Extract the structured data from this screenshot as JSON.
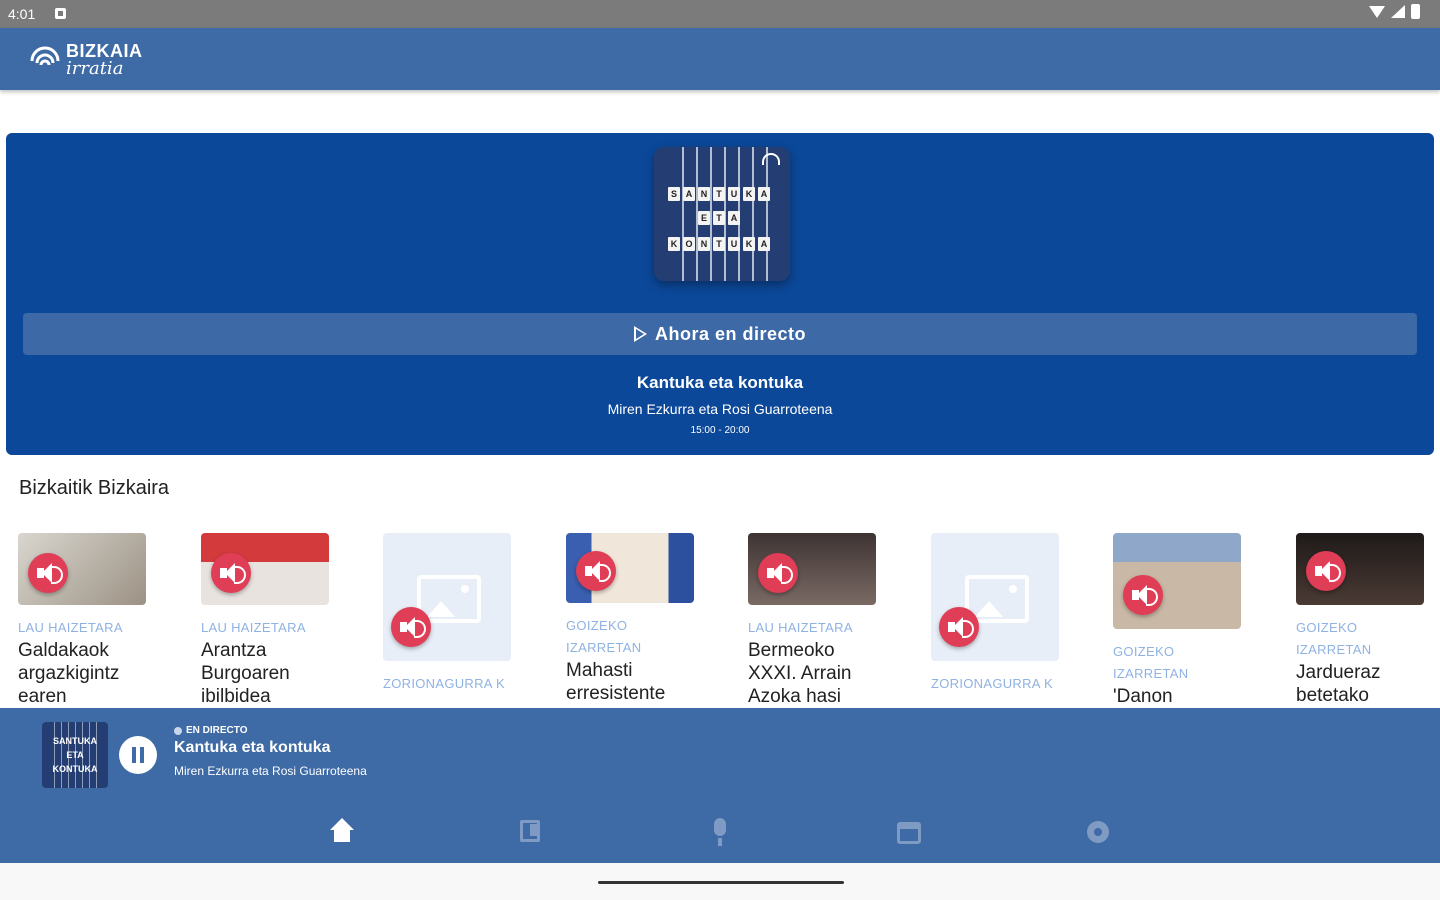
{
  "status_bar": {
    "time": "4:01"
  },
  "app": {
    "logo_line1": "BIZKAIA",
    "logo_line2": "irratia"
  },
  "hero": {
    "cover_rows": [
      [
        "S",
        "A",
        "N",
        "T",
        "U",
        "K",
        "A"
      ],
      [
        "E",
        "T",
        "A"
      ],
      [
        "K",
        "O",
        "N",
        "T",
        "U",
        "K",
        "A"
      ]
    ],
    "live_button_label": "Ahora en directo",
    "program_title": "Kantuka eta kontuka",
    "hosts": "Miren Ezkurra eta Rosi Guarroteena",
    "hours": "15:00 - 20:00"
  },
  "section": {
    "title": "Bizkaitik Bizkaira"
  },
  "cards": [
    {
      "category": "LAU HAIZETARA",
      "title": "Galdakaok argazkigintz earen",
      "thumb_color": "#b9b1a4"
    },
    {
      "category": "LAU HAIZETARA",
      "title": "Arantza Burgoaren ibilbidea",
      "thumb_color": "#c8373b"
    },
    {
      "category": "ZORIONAGURRA K",
      "title": "",
      "thumb_color": "#e8eef7"
    },
    {
      "category": "GOIZEKO IZARRETAN",
      "title": "Mahasti erresistente",
      "thumb_color": "#3a5fb0"
    },
    {
      "category": "LAU HAIZETARA",
      "title": "Bermeoko XXXI. Arrain Azoka hasi",
      "thumb_color": "#5a4b46"
    },
    {
      "category": "ZORIONAGURRA K",
      "title": "",
      "thumb_color": "#e8eef7"
    },
    {
      "category": "GOIZEKO IZARRETAN",
      "title": "'Danon",
      "thumb_color": "#b5a59a"
    },
    {
      "category": "GOIZEKO IZARRETAN",
      "title": "Jardueraz betetako",
      "thumb_color": "#2b2422"
    }
  ],
  "player": {
    "live_label": "EN DIRECTO",
    "title": "Kantuka eta kontuka",
    "hosts": "Miren Ezkurra eta Rosi Guarroteena",
    "art_rows": [
      "SANTUKA",
      "ETA",
      "KONTUKA"
    ]
  },
  "nav": {
    "items": [
      {
        "icon": "home-icon",
        "active": true
      },
      {
        "icon": "news-icon",
        "active": false
      },
      {
        "icon": "mic-icon",
        "active": false
      },
      {
        "icon": "calendar-icon",
        "active": false
      },
      {
        "icon": "gear-icon",
        "active": false
      }
    ]
  },
  "colors": {
    "appbar": "#3e6aa5",
    "hero": "#0b4899",
    "accent_red": "#e03d56",
    "category": "#8fb2e3"
  }
}
